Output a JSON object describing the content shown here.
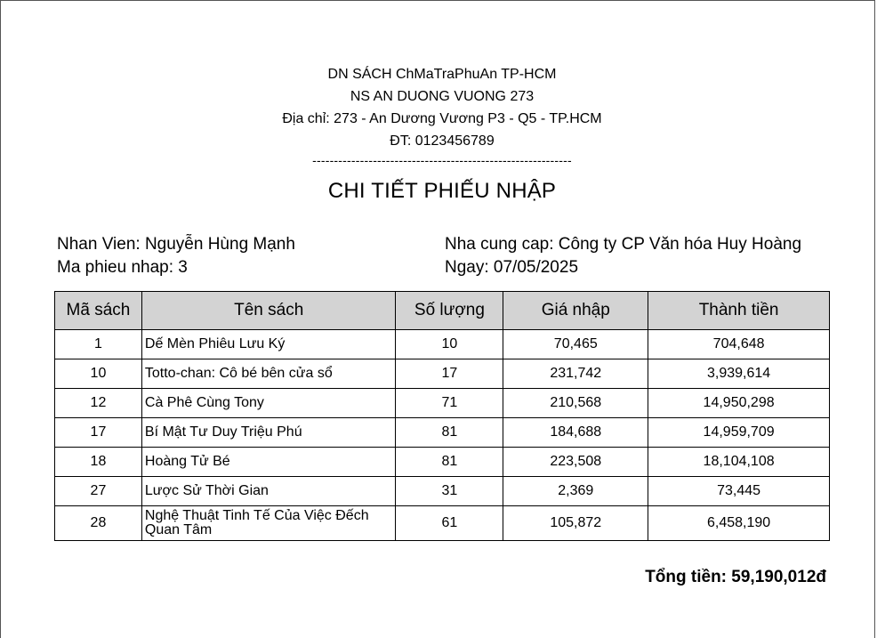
{
  "header": {
    "company": "DN SÁCH ChMaTraPhuAn TP-HCM",
    "store": "NS AN DUONG VUONG 273",
    "address": "Địa chỉ: 273 - An Dương Vương P3 - Q5 - TP.HCM",
    "phone": "ĐT: 0123456789",
    "separator": "------------------------------------------------------------"
  },
  "title": "CHI TIẾT PHIẾU NHẬP",
  "info": {
    "staff": "Nhan Vien: Nguyễn Hùng Mạnh",
    "receipt_id": "Ma phieu nhap: 3",
    "supplier": "Nha cung cap: Công ty CP Văn hóa Huy Hoàng",
    "date": "Ngay: 07/05/2025"
  },
  "table": {
    "headers": [
      "Mã sách",
      "Tên sách",
      "Số lượng",
      "Giá nhập",
      "Thành tiền"
    ],
    "rows": [
      {
        "id": "1",
        "name": "Dế Mèn Phiêu Lưu Ký",
        "qty": "10",
        "price": "70,465",
        "total": "704,648"
      },
      {
        "id": "10",
        "name": "Totto-chan: Cô bé bên cửa sổ",
        "qty": "17",
        "price": "231,742",
        "total": "3,939,614"
      },
      {
        "id": "12",
        "name": "Cà Phê Cùng Tony",
        "qty": "71",
        "price": "210,568",
        "total": "14,950,298"
      },
      {
        "id": "17",
        "name": "Bí Mật Tư Duy Triệu Phú",
        "qty": "81",
        "price": "184,688",
        "total": "14,959,709"
      },
      {
        "id": "18",
        "name": "Hoàng Tử Bé",
        "qty": "81",
        "price": "223,508",
        "total": "18,104,108"
      },
      {
        "id": "27",
        "name": "Lược Sử Thời Gian",
        "qty": "31",
        "price": "2,369",
        "total": "73,445"
      },
      {
        "id": "28",
        "name": "Nghệ Thuật Tinh Tế Của Việc Đếch Quan Tâm",
        "qty": "61",
        "price": "105,872",
        "total": "6,458,190"
      }
    ]
  },
  "total": "Tổng tiền: 59,190,012đ"
}
